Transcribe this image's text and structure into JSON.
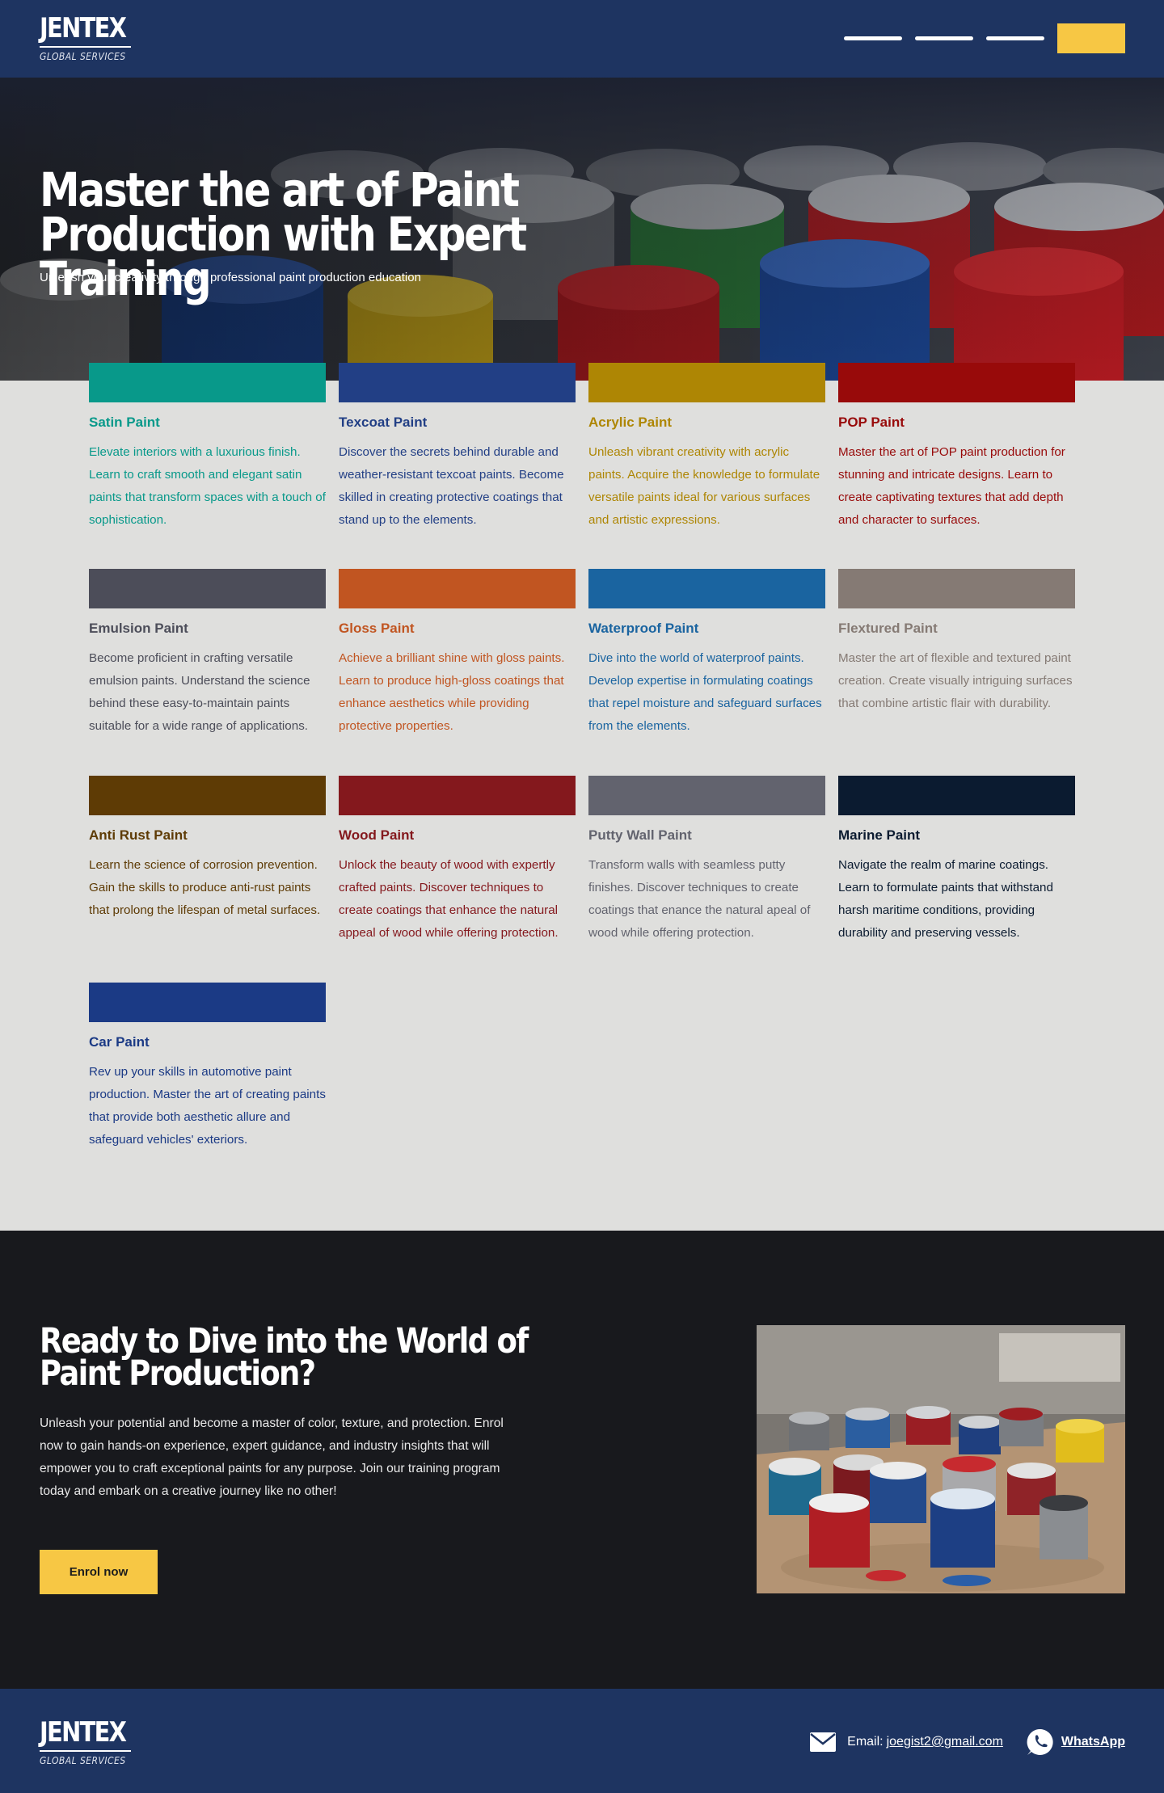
{
  "header": {
    "logo_main": "JENTEX",
    "logo_sub": "GLOBAL SERVICES",
    "nav_items": [
      "",
      "",
      ""
    ],
    "cta_label": ""
  },
  "hero": {
    "title": "Master the art of Paint Production with Expert Training",
    "subtitle": "Unleash your creativity through professional paint production education"
  },
  "courses": [
    {
      "title": "Satin Paint",
      "desc": "Elevate interiors with a luxurious finish. Learn to craft smooth and elegant satin paints that transform spaces with a touch of sophistication.",
      "color": "#08998a"
    },
    {
      "title": "Texcoat Paint",
      "desc": "Discover the secrets behind durable and weather-resistant texcoat paints. Become skilled in creating protective coatings that stand up to the elements.",
      "color": "#223f85"
    },
    {
      "title": "Acrylic Paint",
      "desc": "Unleash vibrant creativity with acrylic paints. Acquire the knowledge to formulate versatile paints ideal for various surfaces and artistic expressions.",
      "color": "#ae8604"
    },
    {
      "title": "POP Paint",
      "desc": "Master the art of POP paint production for stunning and intricate designs. Learn to create captivating textures that add depth and character to surfaces.",
      "color": "#980a0a"
    },
    {
      "title": "Emulsion Paint",
      "desc": "Become proficient in crafting versatile emulsion paints. Understand the science behind these easy-to-maintain paints suitable for a wide range of applications.",
      "color": "#4c4d59"
    },
    {
      "title": "Gloss Paint",
      "desc": "Achieve a brilliant shine with gloss paints. Learn to produce high-gloss coatings that enhance aesthetics while providing protective properties.",
      "color": "#c15521"
    },
    {
      "title": "Waterproof Paint",
      "desc": "Dive into the world of waterproof paints. Develop expertise in formulating coatings that repel moisture and safeguard surfaces from the elements.",
      "color": "#1a64a0"
    },
    {
      "title": "Flextured Paint",
      "desc": "Master the art of flexible and textured paint creation. Create visually intriguing surfaces that combine artistic flair with durability.",
      "color": "#857a74"
    },
    {
      "title": "Anti Rust Paint",
      "desc": "Learn the science of corrosion prevention. Gain the skills to produce anti-rust paints that prolong the lifespan of metal surfaces.",
      "color": "#5e3b05"
    },
    {
      "title": "Wood Paint",
      "desc": "Unlock the beauty of wood with expertly crafted paints. Discover techniques to create coatings that enhance the natural appeal of wood while offering protection.",
      "color": "#84181d"
    },
    {
      "title": "Putty Wall Paint",
      "desc": "Transform walls with seamless putty finishes. Discover techniques to create coatings that enance the natural apeal of wood while offering protection.",
      "color": "#62636e"
    },
    {
      "title": "Marine Paint",
      "desc": "Navigate the realm of marine coatings. Learn to formulate paints that withstand harsh maritime conditions, providing durability and preserving vessels.",
      "color": "#0b1b30"
    },
    {
      "title": "Car Paint",
      "desc": "Rev up your skills in automotive paint production. Master the art of creating paints that provide both aesthetic allure and safeguard vehicles' exteriors.",
      "color": "#1b3a85"
    }
  ],
  "cta": {
    "title": "Ready to Dive into the World of Paint Production?",
    "text": "Unleash your potential and become a master of color, texture, and protection. Enrol now to gain hands-on experience, expert guidance, and industry insights that will empower you to craft exceptional paints for any purpose. Join our training program today and embark on a creative journey like no other!",
    "button_label": "Enrol now"
  },
  "footer": {
    "logo_main": "JENTEX",
    "logo_sub": "GLOBAL SERVICES",
    "email_label": "Email:",
    "email": "joegist2@gmail.com",
    "whatsapp_label": "WhatsApp"
  },
  "colors": {
    "navy": "#1e3461",
    "accent_yellow": "#f7c744",
    "dark": "#18191d",
    "background": "#dfdfdd"
  },
  "icons": [
    "mail-icon",
    "whatsapp-icon"
  ]
}
